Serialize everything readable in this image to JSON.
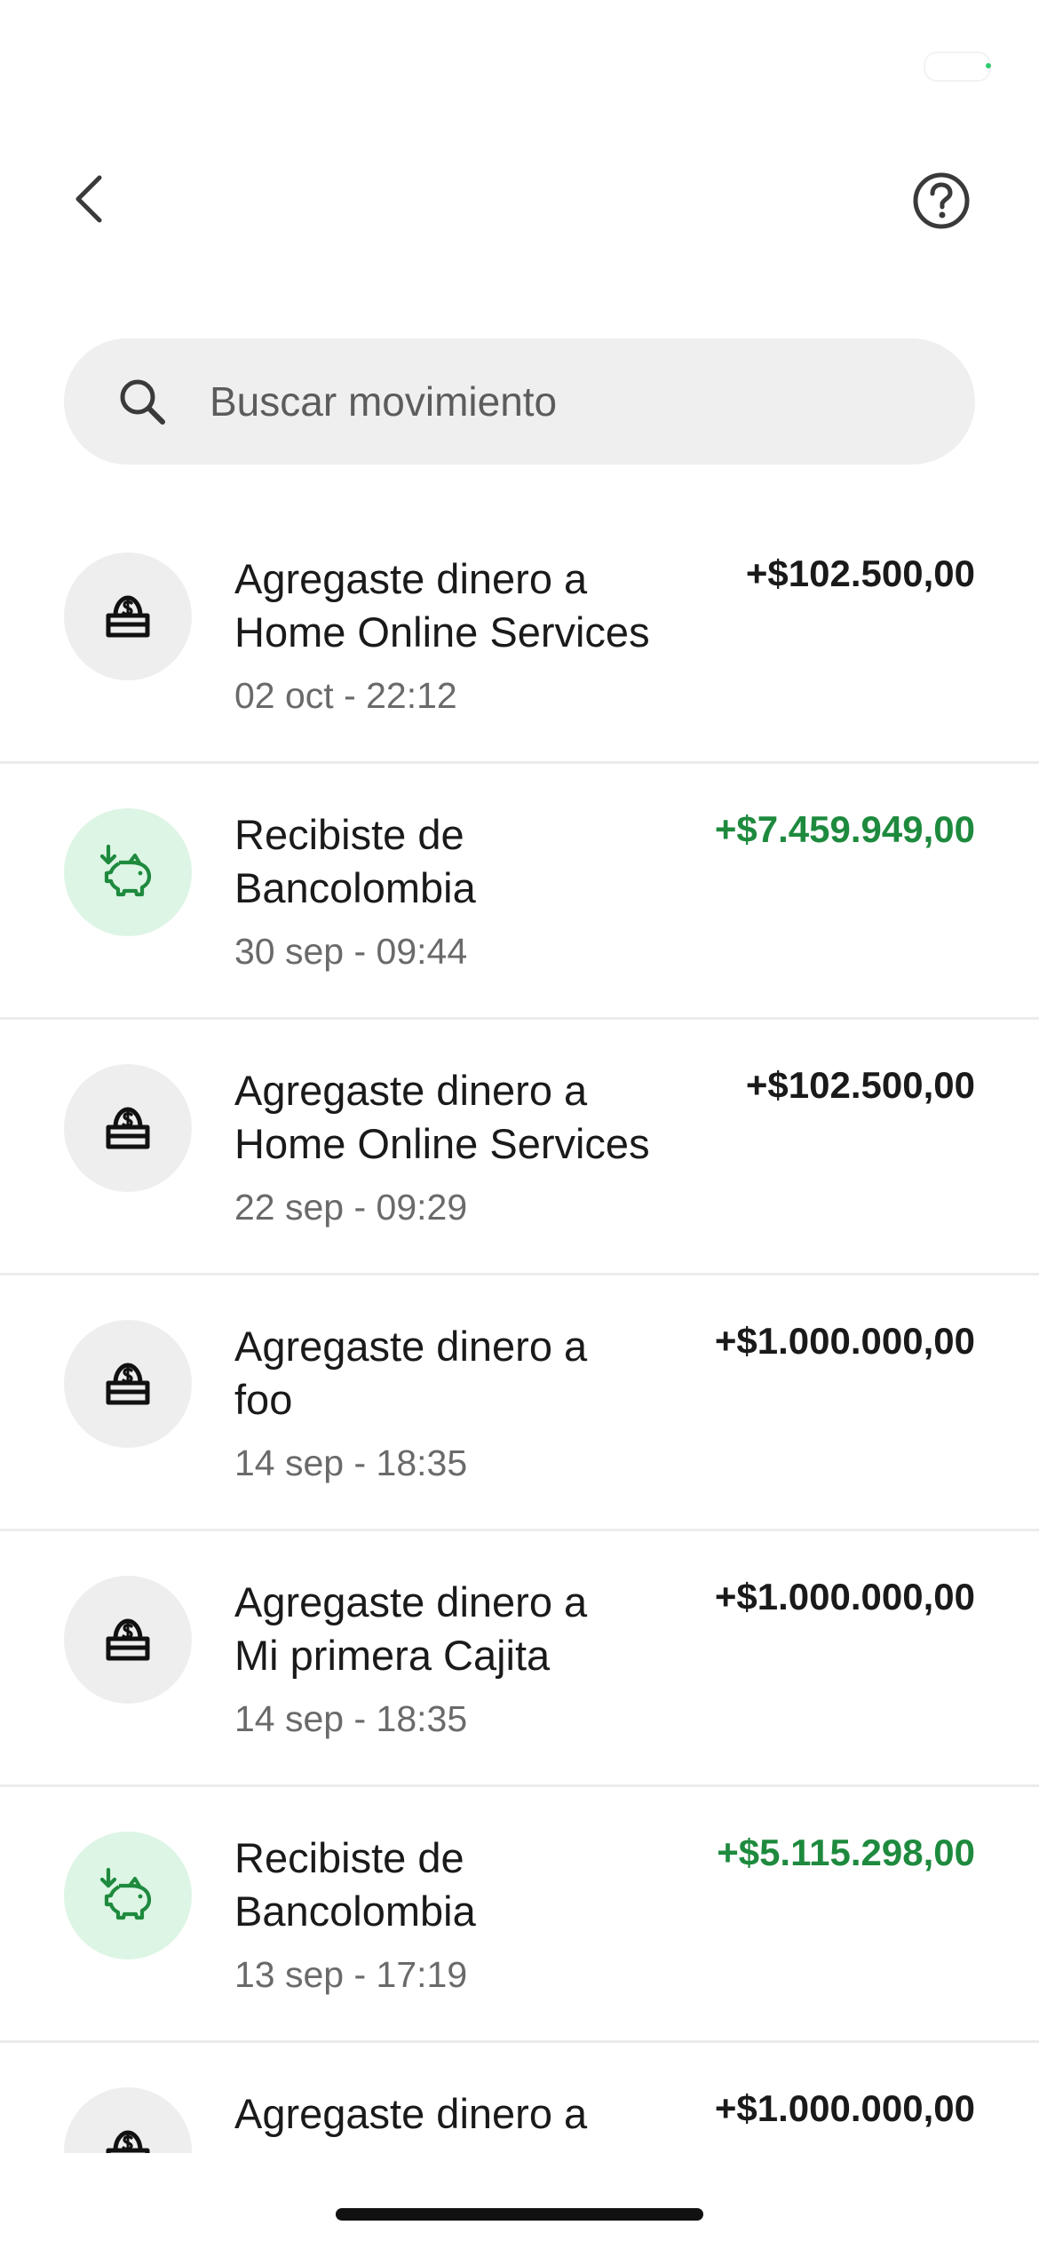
{
  "search": {
    "placeholder": "Buscar movimiento"
  },
  "colors": {
    "income_amount": "#1e8a3e",
    "income_avatar_bg": "#ddf5e4",
    "neutral_avatar_bg": "#eeeeee",
    "search_bg": "#efefef"
  },
  "transactions": [
    {
      "title_line1": "Agregaste dinero a",
      "title_line2": "Home Online Services",
      "date": "02 oct - 22:12",
      "amount": "+$102.500,00",
      "icon": "cajita-icon",
      "type": "neutral"
    },
    {
      "title_line1": "Recibiste de",
      "title_line2": "Bancolombia",
      "date": "30 sep - 09:44",
      "amount": "+$7.459.949,00",
      "icon": "piggy-bank-icon",
      "type": "income"
    },
    {
      "title_line1": "Agregaste dinero a",
      "title_line2": "Home Online Services",
      "date": "22 sep - 09:29",
      "amount": "+$102.500,00",
      "icon": "cajita-icon",
      "type": "neutral"
    },
    {
      "title_line1": "Agregaste dinero a",
      "title_line2": "foo",
      "date": "14 sep - 18:35",
      "amount": "+$1.000.000,00",
      "icon": "cajita-icon",
      "type": "neutral"
    },
    {
      "title_line1": "Agregaste dinero a",
      "title_line2": "Mi primera Cajita",
      "date": "14 sep - 18:35",
      "amount": "+$1.000.000,00",
      "icon": "cajita-icon",
      "type": "neutral"
    },
    {
      "title_line1": "Recibiste de",
      "title_line2": "Bancolombia",
      "date": "13 sep - 17:19",
      "amount": "+$5.115.298,00",
      "icon": "piggy-bank-icon",
      "type": "income"
    },
    {
      "title_line1": "Agregaste dinero a",
      "title_line2": "",
      "date": "",
      "amount": "+$1.000.000,00",
      "icon": "cajita-icon",
      "type": "neutral"
    }
  ]
}
